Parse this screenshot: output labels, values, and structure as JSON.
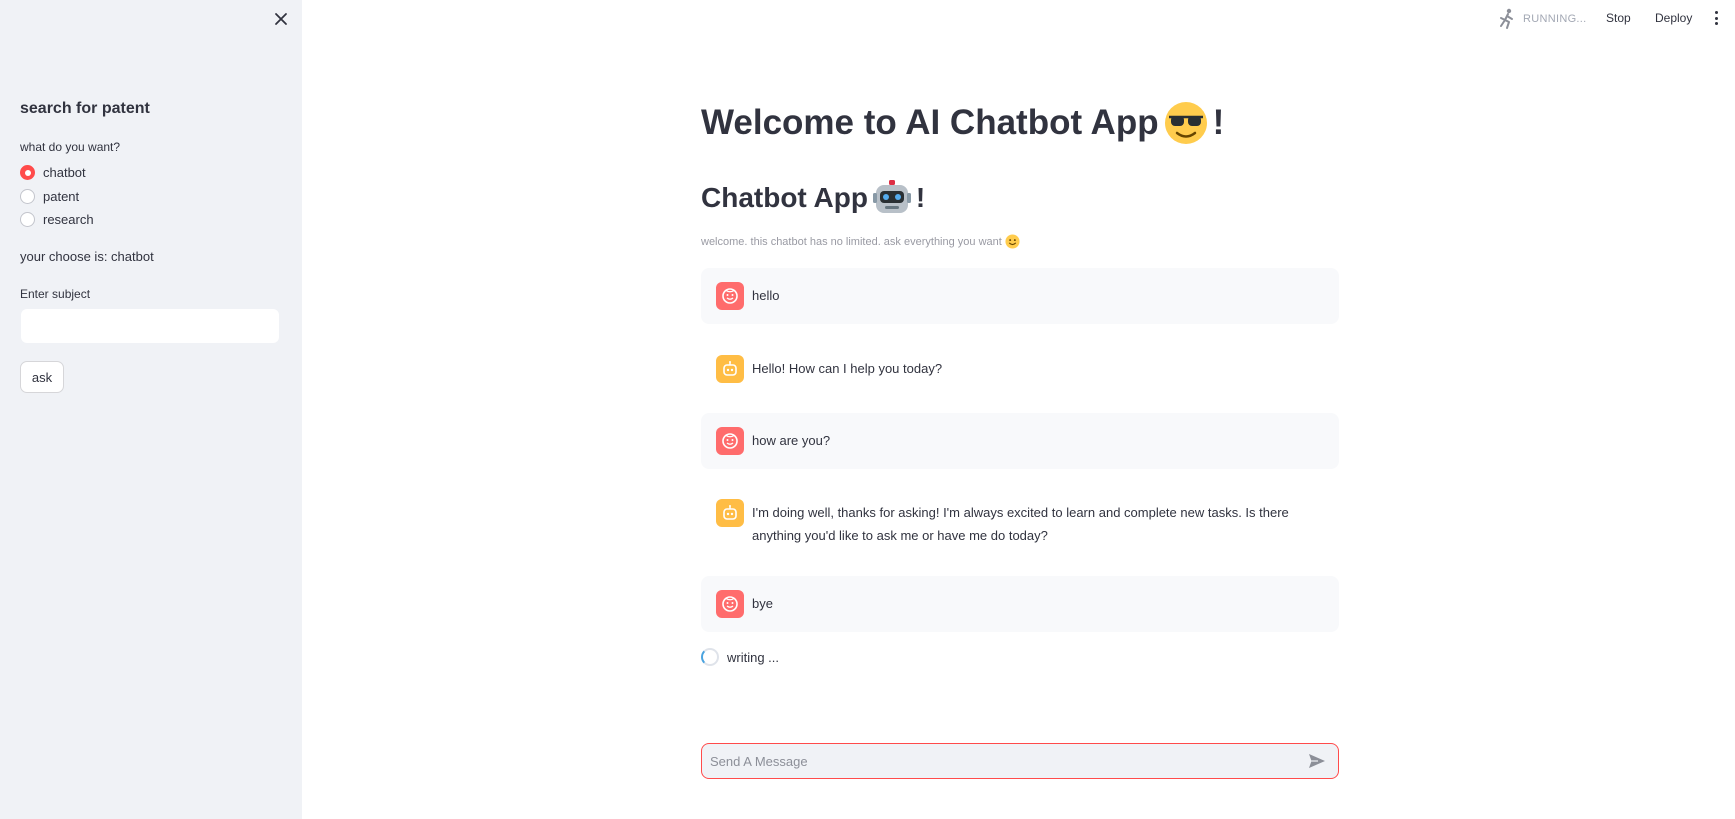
{
  "header": {
    "status_text": "RUNNING...",
    "stop_label": "Stop",
    "deploy_label": "Deploy"
  },
  "sidebar": {
    "title": "search for patent",
    "radio_label": "what do you want?",
    "options": [
      "chatbot",
      "patent",
      "research"
    ],
    "selected_option": "chatbot",
    "chosen_text": "your choose is: chatbot",
    "subject_label": "Enter subject",
    "subject_value": "",
    "ask_label": "ask"
  },
  "main": {
    "title": "Welcome to AI Chatbot App",
    "title_suffix": "!",
    "subtitle": "Chatbot App",
    "subtitle_suffix": "!",
    "caption": "welcome. this chatbot has no limited. ask everything you want",
    "messages": [
      {
        "role": "user",
        "text": "hello"
      },
      {
        "role": "assistant",
        "text": "Hello! How can I help you today?"
      },
      {
        "role": "user",
        "text": "how are you?"
      },
      {
        "role": "assistant",
        "text": "I'm doing well, thanks for asking! I'm always excited to learn and complete new tasks. Is there anything you'd like to ask me or have me do today?"
      },
      {
        "role": "user",
        "text": "bye"
      }
    ],
    "spinner_text": "writing ...",
    "input_placeholder": "Send A Message"
  },
  "colors": {
    "accent": "#ff4b4b",
    "user_avatar": "#ff6c6c",
    "bot_avatar": "#ffbd45",
    "sidebar_bg": "#f0f2f6"
  },
  "icons": {
    "close": "close-icon",
    "running": "running-man-icon",
    "menu": "kebab-menu-icon",
    "title_emoji": "sunglasses-face-icon",
    "subtitle_emoji": "robot-face-icon",
    "caption_emoji": "smiling-face-icon",
    "user_avatar": "user-face-icon",
    "bot_avatar": "bot-face-icon",
    "send": "send-icon"
  }
}
